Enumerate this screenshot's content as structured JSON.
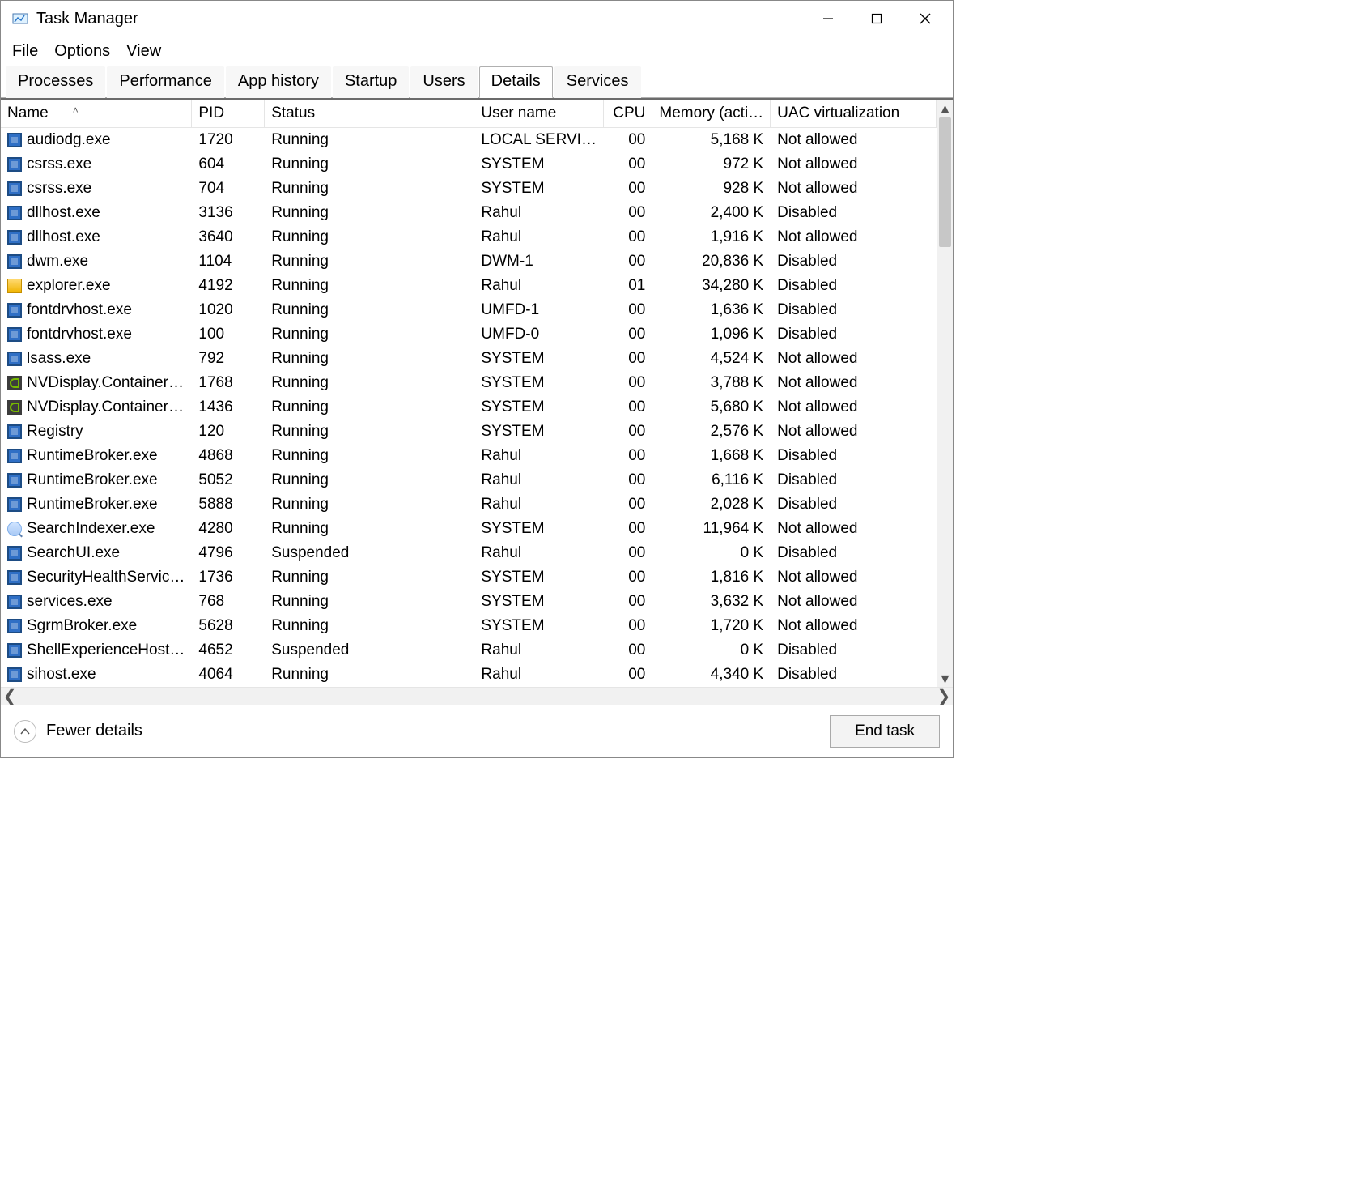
{
  "window": {
    "title": "Task Manager"
  },
  "menu": {
    "items": [
      "File",
      "Options",
      "View"
    ]
  },
  "tabs": {
    "items": [
      "Processes",
      "Performance",
      "App history",
      "Startup",
      "Users",
      "Details",
      "Services"
    ],
    "active_index": 5
  },
  "columns": {
    "name": "Name",
    "pid": "PID",
    "status": "Status",
    "user": "User name",
    "cpu": "CPU",
    "mem": "Memory (acti…",
    "uac": "UAC virtualization"
  },
  "processes": [
    {
      "icon": "generic",
      "name": "audiodg.exe",
      "pid": "1720",
      "status": "Running",
      "user": "LOCAL SERVI…",
      "cpu": "00",
      "mem": "5,168 K",
      "uac": "Not allowed"
    },
    {
      "icon": "generic",
      "name": "csrss.exe",
      "pid": "604",
      "status": "Running",
      "user": "SYSTEM",
      "cpu": "00",
      "mem": "972 K",
      "uac": "Not allowed"
    },
    {
      "icon": "generic",
      "name": "csrss.exe",
      "pid": "704",
      "status": "Running",
      "user": "SYSTEM",
      "cpu": "00",
      "mem": "928 K",
      "uac": "Not allowed"
    },
    {
      "icon": "generic",
      "name": "dllhost.exe",
      "pid": "3136",
      "status": "Running",
      "user": "Rahul",
      "cpu": "00",
      "mem": "2,400 K",
      "uac": "Disabled"
    },
    {
      "icon": "generic",
      "name": "dllhost.exe",
      "pid": "3640",
      "status": "Running",
      "user": "Rahul",
      "cpu": "00",
      "mem": "1,916 K",
      "uac": "Not allowed"
    },
    {
      "icon": "generic",
      "name": "dwm.exe",
      "pid": "1104",
      "status": "Running",
      "user": "DWM-1",
      "cpu": "00",
      "mem": "20,836 K",
      "uac": "Disabled"
    },
    {
      "icon": "explorer",
      "name": "explorer.exe",
      "pid": "4192",
      "status": "Running",
      "user": "Rahul",
      "cpu": "01",
      "mem": "34,280 K",
      "uac": "Disabled"
    },
    {
      "icon": "generic",
      "name": "fontdrvhost.exe",
      "pid": "1020",
      "status": "Running",
      "user": "UMFD-1",
      "cpu": "00",
      "mem": "1,636 K",
      "uac": "Disabled"
    },
    {
      "icon": "generic",
      "name": "fontdrvhost.exe",
      "pid": "100",
      "status": "Running",
      "user": "UMFD-0",
      "cpu": "00",
      "mem": "1,096 K",
      "uac": "Disabled"
    },
    {
      "icon": "generic",
      "name": "lsass.exe",
      "pid": "792",
      "status": "Running",
      "user": "SYSTEM",
      "cpu": "00",
      "mem": "4,524 K",
      "uac": "Not allowed"
    },
    {
      "icon": "nvidia",
      "name": "NVDisplay.Container…",
      "pid": "1768",
      "status": "Running",
      "user": "SYSTEM",
      "cpu": "00",
      "mem": "3,788 K",
      "uac": "Not allowed"
    },
    {
      "icon": "nvidia",
      "name": "NVDisplay.Container…",
      "pid": "1436",
      "status": "Running",
      "user": "SYSTEM",
      "cpu": "00",
      "mem": "5,680 K",
      "uac": "Not allowed"
    },
    {
      "icon": "generic",
      "name": "Registry",
      "pid": "120",
      "status": "Running",
      "user": "SYSTEM",
      "cpu": "00",
      "mem": "2,576 K",
      "uac": "Not allowed"
    },
    {
      "icon": "generic",
      "name": "RuntimeBroker.exe",
      "pid": "4868",
      "status": "Running",
      "user": "Rahul",
      "cpu": "00",
      "mem": "1,668 K",
      "uac": "Disabled"
    },
    {
      "icon": "generic",
      "name": "RuntimeBroker.exe",
      "pid": "5052",
      "status": "Running",
      "user": "Rahul",
      "cpu": "00",
      "mem": "6,116 K",
      "uac": "Disabled"
    },
    {
      "icon": "generic",
      "name": "RuntimeBroker.exe",
      "pid": "5888",
      "status": "Running",
      "user": "Rahul",
      "cpu": "00",
      "mem": "2,028 K",
      "uac": "Disabled"
    },
    {
      "icon": "search",
      "name": "SearchIndexer.exe",
      "pid": "4280",
      "status": "Running",
      "user": "SYSTEM",
      "cpu": "00",
      "mem": "11,964 K",
      "uac": "Not allowed"
    },
    {
      "icon": "generic",
      "name": "SearchUI.exe",
      "pid": "4796",
      "status": "Suspended",
      "user": "Rahul",
      "cpu": "00",
      "mem": "0 K",
      "uac": "Disabled"
    },
    {
      "icon": "generic",
      "name": "SecurityHealthServic…",
      "pid": "1736",
      "status": "Running",
      "user": "SYSTEM",
      "cpu": "00",
      "mem": "1,816 K",
      "uac": "Not allowed"
    },
    {
      "icon": "generic",
      "name": "services.exe",
      "pid": "768",
      "status": "Running",
      "user": "SYSTEM",
      "cpu": "00",
      "mem": "3,632 K",
      "uac": "Not allowed"
    },
    {
      "icon": "generic",
      "name": "SgrmBroker.exe",
      "pid": "5628",
      "status": "Running",
      "user": "SYSTEM",
      "cpu": "00",
      "mem": "1,720 K",
      "uac": "Not allowed"
    },
    {
      "icon": "generic",
      "name": "ShellExperienceHost…",
      "pid": "4652",
      "status": "Suspended",
      "user": "Rahul",
      "cpu": "00",
      "mem": "0 K",
      "uac": "Disabled"
    },
    {
      "icon": "generic",
      "name": "sihost.exe",
      "pid": "4064",
      "status": "Running",
      "user": "Rahul",
      "cpu": "00",
      "mem": "4,340 K",
      "uac": "Disabled"
    }
  ],
  "footer": {
    "fewer_details": "Fewer details",
    "end_task": "End task"
  }
}
